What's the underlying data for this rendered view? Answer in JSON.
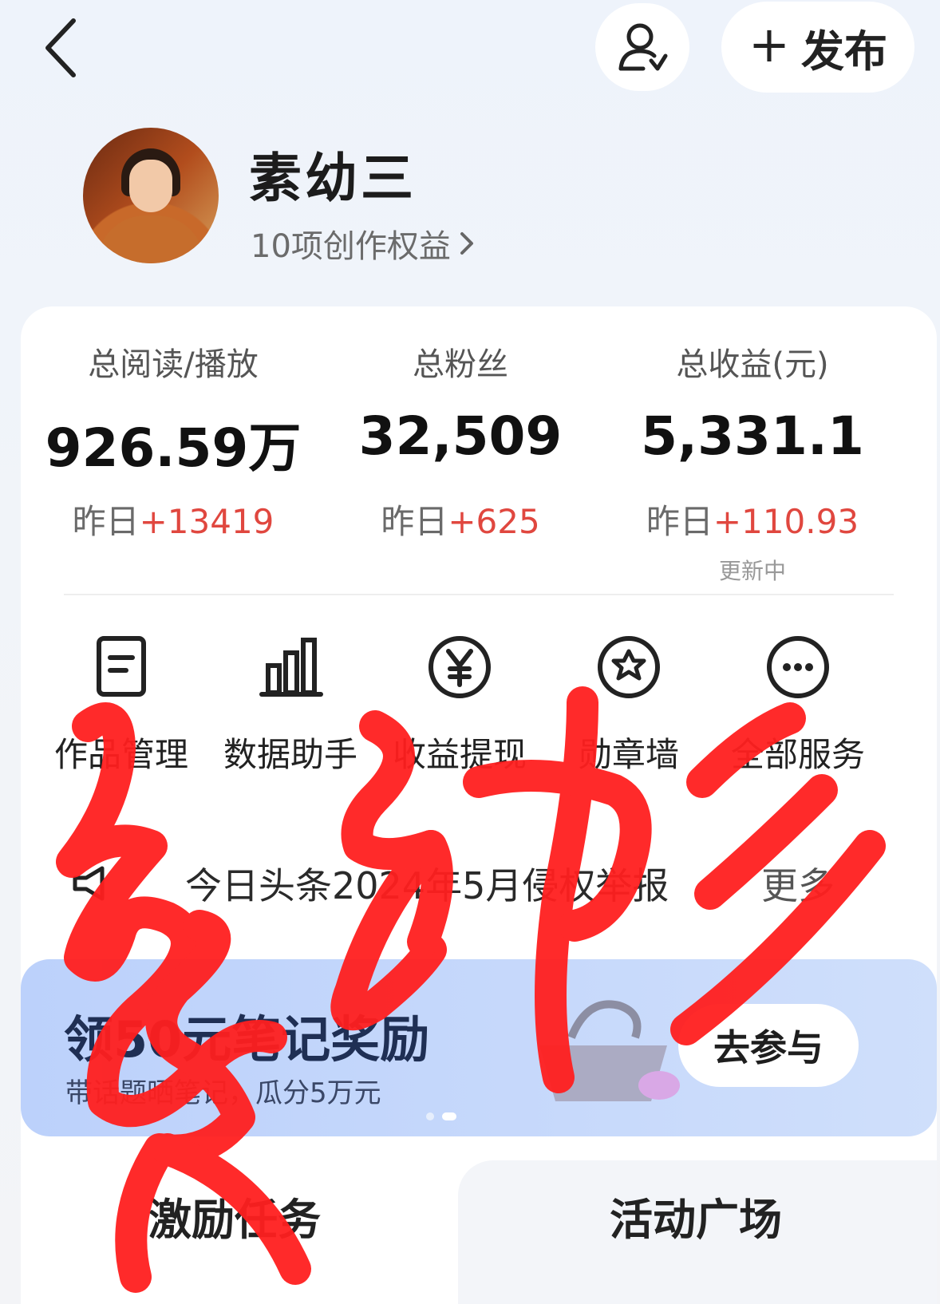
{
  "header": {
    "back_icon": "chevron-left-icon",
    "user_icon": "user-verified-icon",
    "publish_label": "发布"
  },
  "profile": {
    "name": "素幼三",
    "rights_link": "10项创作权益"
  },
  "stats": [
    {
      "label": "总阅读/播放",
      "value": "926.59万",
      "delta_prefix": "昨日",
      "delta": "+13419",
      "note": ""
    },
    {
      "label": "总粉丝",
      "value": "32,509",
      "delta_prefix": "昨日",
      "delta": "+625",
      "note": ""
    },
    {
      "label": "总收益(元)",
      "value": "5,331.1",
      "delta_prefix": "昨日",
      "delta": "+110.93",
      "note": "更新中"
    }
  ],
  "services": [
    {
      "label": "作品管理",
      "icon": "document-icon"
    },
    {
      "label": "数据助手",
      "icon": "bar-chart-icon"
    },
    {
      "label": "收益提现",
      "icon": "yen-icon"
    },
    {
      "label": "勋章墙",
      "icon": "medal-star-icon"
    },
    {
      "label": "全部服务",
      "icon": "more-icon"
    }
  ],
  "notice": {
    "icon": "megaphone-icon",
    "text": "今日头条2024年5月侵权举报",
    "more": "更多"
  },
  "banner": {
    "title": "领50元笔记奖励",
    "subtitle": "带话题晒笔记，瓜分5万元",
    "button": "去参与",
    "page_count": 2,
    "active_page": 1
  },
  "tabs": [
    {
      "label": "激励任务"
    },
    {
      "label": "活动广场"
    }
  ],
  "overlay": {
    "type": "handwritten-signature",
    "color": "#ff1f1f"
  }
}
